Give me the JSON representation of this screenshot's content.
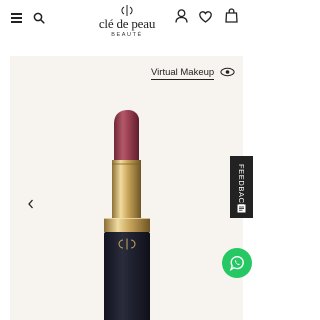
{
  "header": {
    "logo": {
      "name": "clé de peau",
      "subtitle": "BEAUTÉ"
    },
    "icons": {
      "menu": "hamburger-menu-icon",
      "search": "search-icon",
      "account": "user-icon",
      "wishlist": "heart-icon",
      "bag": "shopping-bag-icon"
    }
  },
  "product_view": {
    "virtual_makeup_label": "Virtual Makeup",
    "icons": {
      "virtual_makeup": "eye-icon",
      "previous": "chevron-left-icon"
    },
    "colors": {
      "background": "#f7f4ef",
      "lipstick_bullet": "#9c4150",
      "case_gold": "#c9a65a",
      "case_body": "#1c1d2b"
    }
  },
  "widgets": {
    "feedback_label": "FEEDBACK",
    "whatsapp_icon": "whatsapp-icon",
    "whatsapp_color": "#25c863"
  }
}
